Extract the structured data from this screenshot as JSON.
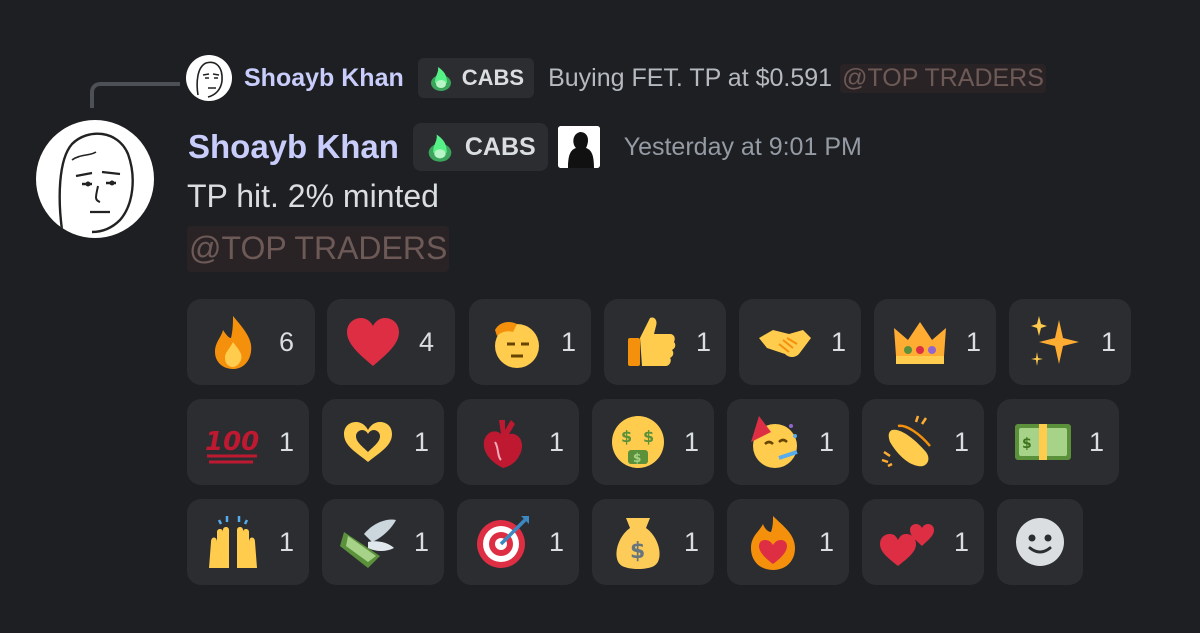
{
  "reply": {
    "author": "Shoayb Khan",
    "tag": "CABS",
    "text": "Buying FET. TP at $0.591",
    "mention": "@TOP TRADERS"
  },
  "message": {
    "author": "Shoayb Khan",
    "tag": "CABS",
    "timestamp": "Yesterday at 9:01 PM",
    "text": "TP hit. 2% minted",
    "mention": "@TOP TRADERS"
  },
  "reactions": [
    {
      "emoji": "fire-icon",
      "count": "6"
    },
    {
      "emoji": "red-heart-icon",
      "count": "4"
    },
    {
      "emoji": "saluting-face-icon",
      "count": "1"
    },
    {
      "emoji": "thumbs-up-icon",
      "count": "1"
    },
    {
      "emoji": "handshake-icon",
      "count": "1"
    },
    {
      "emoji": "crown-icon",
      "count": "1"
    },
    {
      "emoji": "sparkles-icon",
      "count": "1"
    },
    {
      "emoji": "hundred-points-icon",
      "count": "1"
    },
    {
      "emoji": "heart-hands-icon",
      "count": "1"
    },
    {
      "emoji": "anatomical-heart-icon",
      "count": "1"
    },
    {
      "emoji": "money-mouth-face-icon",
      "count": "1"
    },
    {
      "emoji": "partying-face-icon",
      "count": "1"
    },
    {
      "emoji": "clapping-hands-icon",
      "count": "1"
    },
    {
      "emoji": "dollar-banknote-icon",
      "count": "1"
    },
    {
      "emoji": "raising-hands-icon",
      "count": "1"
    },
    {
      "emoji": "money-with-wings-icon",
      "count": "1"
    },
    {
      "emoji": "direct-hit-icon",
      "count": "1"
    },
    {
      "emoji": "money-bag-icon",
      "count": "1"
    },
    {
      "emoji": "heart-on-fire-icon",
      "count": "1"
    },
    {
      "emoji": "two-hearts-icon",
      "count": "1"
    }
  ],
  "colors": {
    "background": "#1e1f22",
    "author": "#c9cdfb",
    "mention": "#6d5a57",
    "timestamp": "#949ba4",
    "pill": "#2b2d31"
  }
}
